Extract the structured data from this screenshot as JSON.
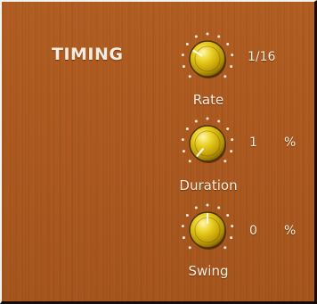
{
  "section": {
    "title": "TIMING"
  },
  "knobs": {
    "rate": {
      "label": "Rate",
      "value": "1/16",
      "unit": "",
      "indicator_angle_deg": -60
    },
    "duration": {
      "label": "Duration",
      "value": "1",
      "unit": "%",
      "indicator_angle_deg": -140
    },
    "swing": {
      "label": "Swing",
      "value": "0",
      "unit": "%",
      "indicator_angle_deg": 0
    }
  },
  "colors": {
    "panel_wood": "#ab591f",
    "knob_gold": "#e8cc1c",
    "text": "#f7ecdd"
  },
  "icons": {
    "knob": "rotary-knob-icon",
    "tick_ring": "dotted-scale-icon"
  }
}
